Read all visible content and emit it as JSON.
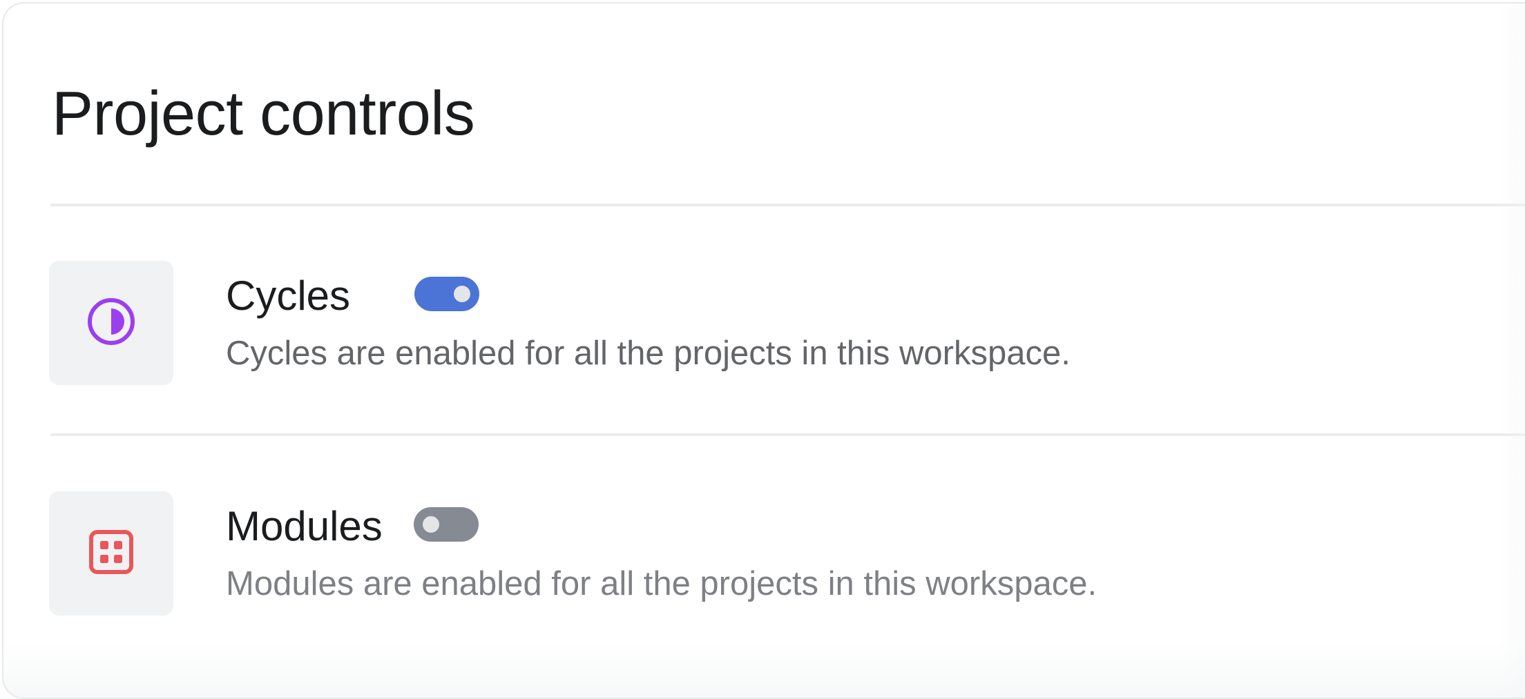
{
  "section": {
    "title": "Project controls"
  },
  "features": [
    {
      "name": "Cycles",
      "description": "Cycles are enabled for all the projects in this workspace.",
      "enabled": true,
      "icon": "cycle-icon",
      "icon_color": "#9b3ff0"
    },
    {
      "name": "Modules",
      "description": "Modules are enabled for all the projects in this workspace.",
      "enabled": false,
      "icon": "module-icon",
      "icon_color": "#e8585a"
    }
  ],
  "colors": {
    "toggle_on": "#4b74d6",
    "toggle_off": "#868a93",
    "icon_box_bg": "#f1f2f3"
  }
}
